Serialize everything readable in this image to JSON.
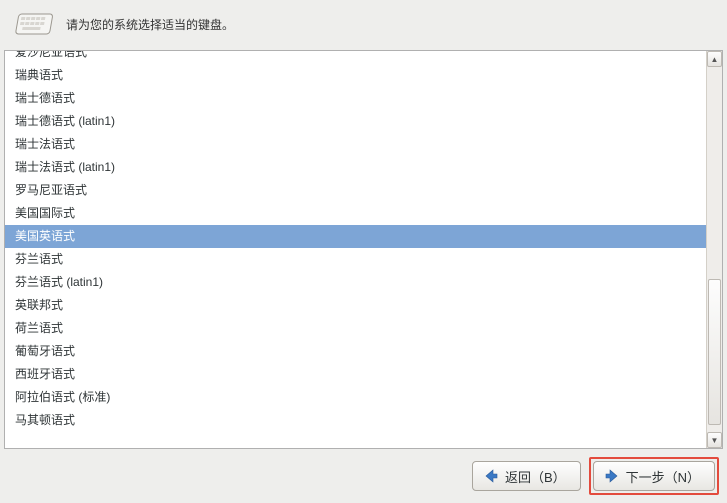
{
  "header": {
    "instruction": "请为您的系统选择适当的键盘。"
  },
  "keyboard_list": {
    "selected_index": 8,
    "items": [
      "爱沙尼亚语式",
      "瑞典语式",
      "瑞士德语式",
      "瑞士德语式 (latin1)",
      "瑞士法语式",
      "瑞士法语式 (latin1)",
      "罗马尼亚语式",
      "美国国际式",
      "美国英语式",
      "芬兰语式",
      "芬兰语式 (latin1)",
      "英联邦式",
      "荷兰语式",
      "葡萄牙语式",
      "西班牙语式",
      "阿拉伯语式 (标准)",
      "马其顿语式"
    ]
  },
  "footer": {
    "back_label": "返回（B）",
    "next_label": "下一步（N）"
  }
}
